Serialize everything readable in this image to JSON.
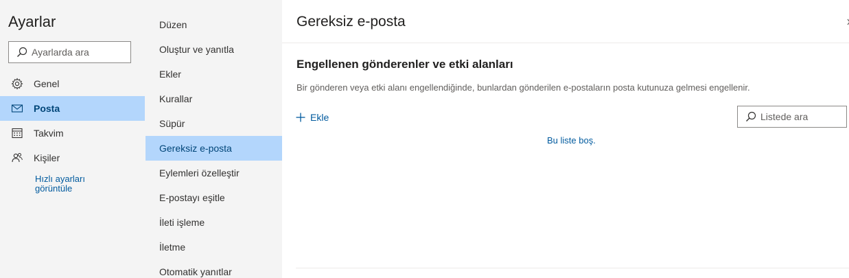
{
  "settings": {
    "title": "Ayarlar",
    "search_placeholder": "Ayarlarda ara"
  },
  "nav": {
    "items": [
      {
        "label": "Genel",
        "icon": "gear-icon"
      },
      {
        "label": "Posta",
        "icon": "mail-icon",
        "selected": true
      },
      {
        "label": "Takvim",
        "icon": "calendar-icon"
      },
      {
        "label": "Kişiler",
        "icon": "people-icon"
      }
    ],
    "quick_settings_link": "Hızlı ayarları görüntüle"
  },
  "mail_categories": {
    "items": [
      {
        "label": "Düzen"
      },
      {
        "label": "Oluştur ve yanıtla"
      },
      {
        "label": "Ekler"
      },
      {
        "label": "Kurallar"
      },
      {
        "label": "Süpür"
      },
      {
        "label": "Gereksiz e-posta",
        "selected": true
      },
      {
        "label": "Eylemleri özelleştir"
      },
      {
        "label": "E-postayı eşitle"
      },
      {
        "label": "İleti işleme"
      },
      {
        "label": "İletme"
      },
      {
        "label": "Otomatik yanıtlar"
      }
    ]
  },
  "content": {
    "title": "Gereksiz e-posta",
    "section_title": "Engellenen gönderenler ve etki alanları",
    "section_description": "Bir gönderen veya etki alanı engellendiğinde, bunlardan gönderilen e-postaların posta kutunuza gelmesi engellenir.",
    "add_label": "Ekle",
    "list_search_placeholder": "Listede ara",
    "empty_message": "Bu liste boş."
  },
  "colors": {
    "accent": "#005a9e",
    "selected_bg": "#b3d6fc",
    "nav_bg": "#f4f4f4"
  }
}
